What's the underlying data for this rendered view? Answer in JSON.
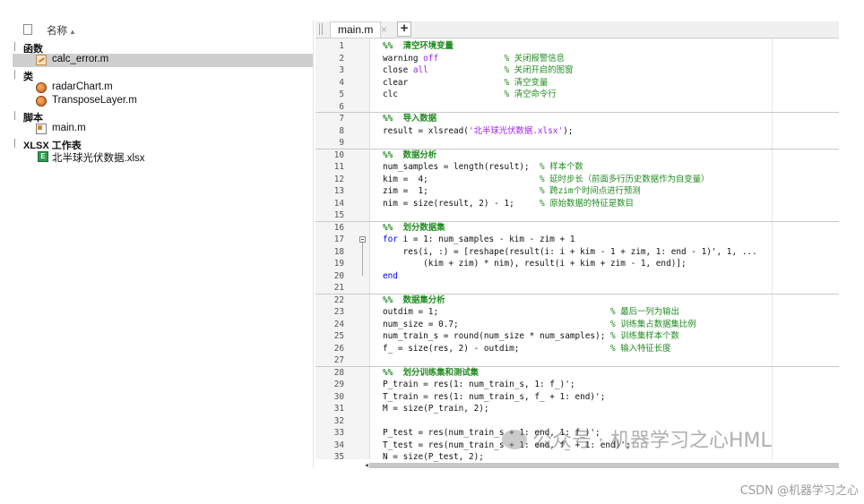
{
  "browser": {
    "column_header": "名称",
    "sort_indicator": "▲",
    "sections": [
      {
        "label": "函数",
        "files": [
          {
            "name": "calc_error.m",
            "icon": "m-function-icon",
            "selected": true
          }
        ]
      },
      {
        "label": "类",
        "files": [
          {
            "name": "radarChart.m",
            "icon": "m-class-icon"
          },
          {
            "name": "TransposeLayer.m",
            "icon": "m-class-icon"
          }
        ]
      },
      {
        "label": "脚本",
        "files": [
          {
            "name": "main.m",
            "icon": "m-script-icon"
          }
        ]
      },
      {
        "label": "XLSX 工作表",
        "files": [
          {
            "name": "北半球光伏数据.xlsx",
            "icon": "xlsx-icon"
          }
        ]
      }
    ]
  },
  "editor": {
    "tab_label": "main.m",
    "tab_close": "×",
    "tab_add": "+",
    "lines": [
      {
        "n": "1",
        "html": "<span class='cell'>%%  清空环境变量</span>"
      },
      {
        "n": "2",
        "html": "warning <span class='str'>off</span>             <span class='cm'>% 关闭报警信息</span>"
      },
      {
        "n": "3",
        "html": "close <span class='str'>all</span>               <span class='cm'>% 关闭开启的图窗</span>"
      },
      {
        "n": "4",
        "html": "clear                   <span class='cm'>% 清空变量</span>"
      },
      {
        "n": "5",
        "html": "clc                     <span class='cm'>% 清空命令行</span>"
      },
      {
        "n": "6",
        "html": ""
      },
      {
        "n": "7",
        "html": "<span class='cell'>%%  导入数据</span>"
      },
      {
        "n": "8",
        "html": "result = xlsread(<span class='str'>'北半球光伏数据.xlsx'</span>);"
      },
      {
        "n": "9",
        "html": ""
      },
      {
        "n": "10",
        "html": "<span class='cell'>%%  数据分析</span>"
      },
      {
        "n": "11",
        "html": "num_samples = length(result);  <span class='cm'>% 样本个数</span>"
      },
      {
        "n": "12",
        "html": "kim =  4;                      <span class='cm'>% 延时步长（前面多行历史数据作为自变量）</span>"
      },
      {
        "n": "13",
        "html": "zim =  1;                      <span class='cm'>% 跨zim个时间点进行预测</span>"
      },
      {
        "n": "14",
        "html": "nim = size(result, 2) - 1;     <span class='cm'>% 原始数据的特征是数目</span>"
      },
      {
        "n": "15",
        "html": ""
      },
      {
        "n": "16",
        "html": "<span class='cell'>%%  划分数据集</span>"
      },
      {
        "n": "17",
        "html": "<span class='kw'>for</span> i = 1: num_samples - kim - zim + 1"
      },
      {
        "n": "18",
        "html": "    res(i, :) = [reshape(result(i: i + kim - 1 + zim, 1: end - 1)', 1, ..."
      },
      {
        "n": "19",
        "html": "        (kim + zim) * nim), result(i + kim + zim - 1, end)];"
      },
      {
        "n": "20",
        "html": "<span class='kw'>end</span>"
      },
      {
        "n": "21",
        "html": ""
      },
      {
        "n": "22",
        "html": "<span class='cell'>%%  数据集分析</span>"
      },
      {
        "n": "23",
        "html": "outdim = 1;                                  <span class='cm'>% 最后一列为输出</span>"
      },
      {
        "n": "24",
        "html": "num_size = 0.7;                              <span class='cm'>% 训练集占数据集比例</span>"
      },
      {
        "n": "25",
        "html": "num_train_s = round(num_size * num_samples); <span class='cm'>% 训练集样本个数</span>"
      },
      {
        "n": "26",
        "html": "f_ = size(res, 2) - outdim;                  <span class='cm'>% 输入特征长度</span>"
      },
      {
        "n": "27",
        "html": ""
      },
      {
        "n": "28",
        "html": "<span class='cell'>%%  划分训练集和测试集</span>"
      },
      {
        "n": "29",
        "html": "P_train = res(1: num_train_s, 1: f_)';"
      },
      {
        "n": "30",
        "html": "T_train = res(1: num_train_s, f_ + 1: end)';"
      },
      {
        "n": "31",
        "html": "M = size(P_train, 2);"
      },
      {
        "n": "32",
        "html": ""
      },
      {
        "n": "33",
        "html": "P_test = res(num_train_s + 1: end, 1: f_)';"
      },
      {
        "n": "34",
        "html": "T_test = res(num_train_s + 1: end, f_ + 1: end)';"
      },
      {
        "n": "35",
        "html": "N = size(P_test, 2);"
      }
    ]
  },
  "watermark": "公众号 · 机器学习之心HML",
  "credit": "CSDN @机器学习之心"
}
